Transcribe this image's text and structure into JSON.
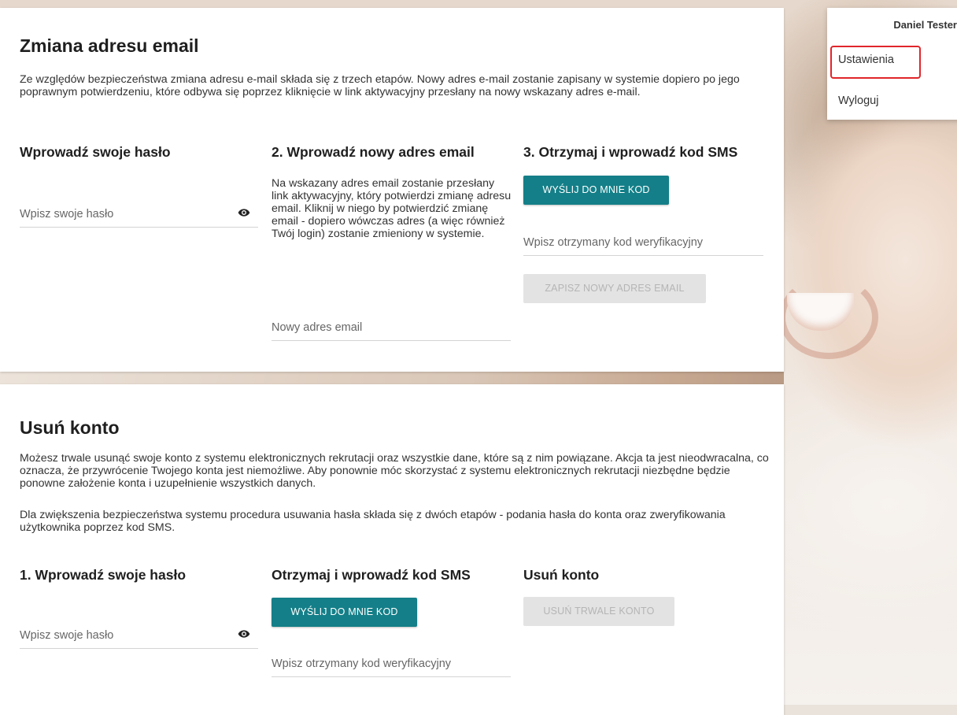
{
  "user_menu": {
    "user_name": "Daniel Tester",
    "items": [
      "Ustawienia",
      "Wyloguj"
    ],
    "highlighted_item": "Ustawienia"
  },
  "email_change": {
    "title": "Zmiana adresu email",
    "description": "Ze względów bezpieczeństwa zmiana adresu e-mail składa się z trzech etapów. Nowy adres e-mail zostanie zapisany w systemie dopiero po jego poprawnym potwierdzeniu, które odbywa się poprzez kliknięcie w link aktywacyjny przesłany na nowy wskazany adres e-mail.",
    "step1": {
      "heading": "Wprowadź swoje hasło",
      "password_placeholder": "Wpisz swoje hasło"
    },
    "step2": {
      "heading": "2. Wprowadź nowy adres email",
      "text": "Na wskazany adres email zostanie przesłany link aktywacyjny, który potwierdzi zmianę adresu email. Kliknij w niego by potwierdzić zmianę email - dopiero wówczas adres (a więc również Twój login) zostanie zmieniony w systemie.",
      "email_placeholder": "Nowy adres email"
    },
    "step3": {
      "heading": "3. Otrzymaj i wprowadź kod SMS",
      "send_code_label": "WYŚLIJ DO MNIE KOD",
      "code_placeholder": "Wpisz otrzymany kod weryfikacyjny",
      "save_label": "ZAPISZ NOWY ADRES EMAIL"
    }
  },
  "delete_account": {
    "title": "Usuń konto",
    "description1": "Możesz trwale usunąć swoje konto z systemu elektronicznych rekrutacji oraz wszystkie dane, które są z nim powiązane. Akcja ta jest nieodwracalna, co oznacza, że przywrócenie Twojego konta jest niemożliwe. Aby ponownie móc skorzystać z systemu elektronicznych rekrutacji niezbędne będzie ponowne założenie konta i uzupełnienie wszystkich danych.",
    "description2": "Dla zwiększenia bezpieczeństwa systemu procedura usuwania hasła składa się z dwóch etapów - podania hasła do konta oraz zweryfikowania użytkownika poprzez kod SMS.",
    "step1": {
      "heading": "1. Wprowadź swoje hasło",
      "password_placeholder": "Wpisz swoje hasło"
    },
    "step2": {
      "heading": "Otrzymaj i wprowadź kod SMS",
      "send_code_label": "WYŚLIJ DO MNIE KOD",
      "code_placeholder": "Wpisz otrzymany kod weryfikacyjny"
    },
    "step3": {
      "heading": "Usuń konto",
      "delete_label": "USUŃ TRWALE KONTO"
    }
  },
  "colors": {
    "primary_button": "#147f88",
    "disabled_button": "#e3e3e3",
    "highlight_border": "#e0262b"
  },
  "icons": {
    "password_toggle": "eye-icon"
  }
}
